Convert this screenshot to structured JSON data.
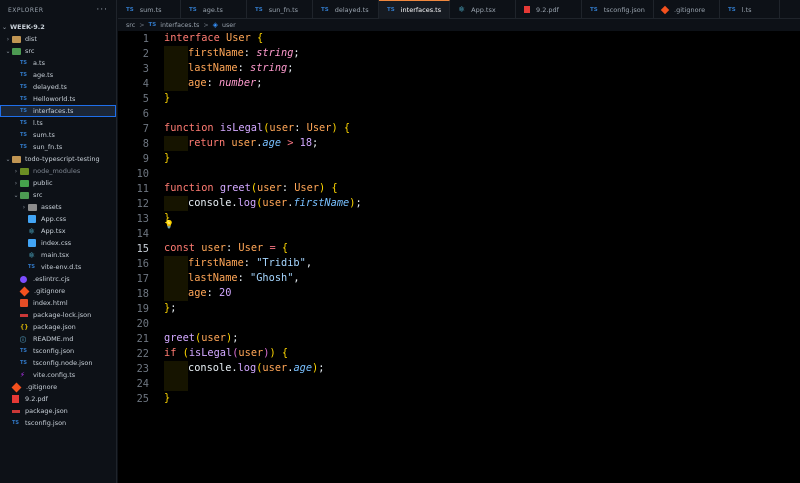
{
  "explorer": {
    "title": "EXPLORER",
    "more": "···",
    "section": "WEEK-9.2",
    "items": [
      {
        "label": "dist",
        "chev": "›",
        "icon": "folder",
        "depth": 1
      },
      {
        "label": "src",
        "chev": "⌄",
        "icon": "folder-src",
        "depth": 1
      },
      {
        "label": "a.ts",
        "icon": "ts",
        "depth": 2
      },
      {
        "label": "age.ts",
        "icon": "ts",
        "depth": 2
      },
      {
        "label": "delayed.ts",
        "icon": "ts",
        "depth": 2
      },
      {
        "label": "Helloworld.ts",
        "icon": "ts",
        "depth": 2
      },
      {
        "label": "interfaces.ts",
        "icon": "ts",
        "depth": 2,
        "active": true
      },
      {
        "label": "l.ts",
        "icon": "ts",
        "depth": 2
      },
      {
        "label": "sum.ts",
        "icon": "ts",
        "depth": 2
      },
      {
        "label": "sun_fn.ts",
        "icon": "ts",
        "depth": 2
      },
      {
        "label": "todo-typescript-testing",
        "chev": "⌄",
        "icon": "folder",
        "depth": 1
      },
      {
        "label": "node_modules",
        "chev": "›",
        "icon": "folder-nm",
        "depth": 2,
        "muted": true
      },
      {
        "label": "public",
        "chev": "›",
        "icon": "folder-pub",
        "depth": 2
      },
      {
        "label": "src",
        "chev": "⌄",
        "icon": "folder-src",
        "depth": 2
      },
      {
        "label": "assets",
        "chev": "›",
        "icon": "folder-assets",
        "depth": 3
      },
      {
        "label": "App.css",
        "icon": "css",
        "depth": 3
      },
      {
        "label": "App.tsx",
        "icon": "react",
        "depth": 3
      },
      {
        "label": "index.css",
        "icon": "css",
        "depth": 3
      },
      {
        "label": "main.tsx",
        "icon": "react",
        "depth": 3
      },
      {
        "label": "vite-env.d.ts",
        "icon": "ts",
        "depth": 3
      },
      {
        "label": ".eslintrc.cjs",
        "icon": "eslint",
        "depth": 2
      },
      {
        "label": ".gitignore",
        "icon": "git",
        "depth": 2
      },
      {
        "label": "index.html",
        "icon": "html",
        "depth": 2
      },
      {
        "label": "package-lock.json",
        "icon": "lockjson",
        "depth": 2
      },
      {
        "label": "package.json",
        "icon": "json",
        "depth": 2
      },
      {
        "label": "README.md",
        "icon": "md",
        "depth": 2
      },
      {
        "label": "tsconfig.json",
        "icon": "ts",
        "depth": 2
      },
      {
        "label": "tsconfig.node.json",
        "icon": "ts",
        "depth": 2
      },
      {
        "label": "vite.config.ts",
        "icon": "vite",
        "depth": 2
      },
      {
        "label": ".gitignore",
        "icon": "git",
        "depth": 1
      },
      {
        "label": "9.2.pdf",
        "icon": "pdf",
        "depth": 1
      },
      {
        "label": "package.json",
        "icon": "lockjson",
        "depth": 1
      },
      {
        "label": "tsconfig.json",
        "icon": "ts",
        "depth": 1
      }
    ]
  },
  "tabs": [
    {
      "label": "sum.ts",
      "icon": "TS"
    },
    {
      "label": "age.ts",
      "icon": "TS"
    },
    {
      "label": "sun_fn.ts",
      "icon": "TS"
    },
    {
      "label": "delayed.ts",
      "icon": "TS"
    },
    {
      "label": "interfaces.ts",
      "icon": "TS",
      "active": true
    },
    {
      "label": "App.tsx",
      "icon": "react"
    },
    {
      "label": "9.2.pdf",
      "icon": "pdf"
    },
    {
      "label": "tsconfig.json",
      "icon": "TS"
    },
    {
      "label": ".gitignore",
      "icon": "git"
    },
    {
      "label": "l.ts",
      "icon": "TS"
    }
  ],
  "breadcrumb": {
    "folder": "src",
    "sep": ">",
    "file_icon": "TS",
    "file": "interfaces.ts",
    "symbol_icon": "◈",
    "symbol": "user"
  },
  "editor": {
    "current_line": 15,
    "lines": [
      "interface User {",
      "    firstName: string;",
      "    lastName: string;",
      "    age: number;",
      "}",
      "",
      "function isLegal(user: User) {",
      "    return user.age > 18;",
      "}",
      "",
      "function greet(user: User) {",
      "    console.log(user.firstName);",
      "}",
      "",
      "const user: User = {",
      "    firstName: \"Tridib\",",
      "    lastName: \"Ghosh\",",
      "    age: 20",
      "};",
      "",
      "greet(user);",
      "if (isLegal(user)) {",
      "    console.log(user.age);",
      "",
      "}"
    ]
  }
}
